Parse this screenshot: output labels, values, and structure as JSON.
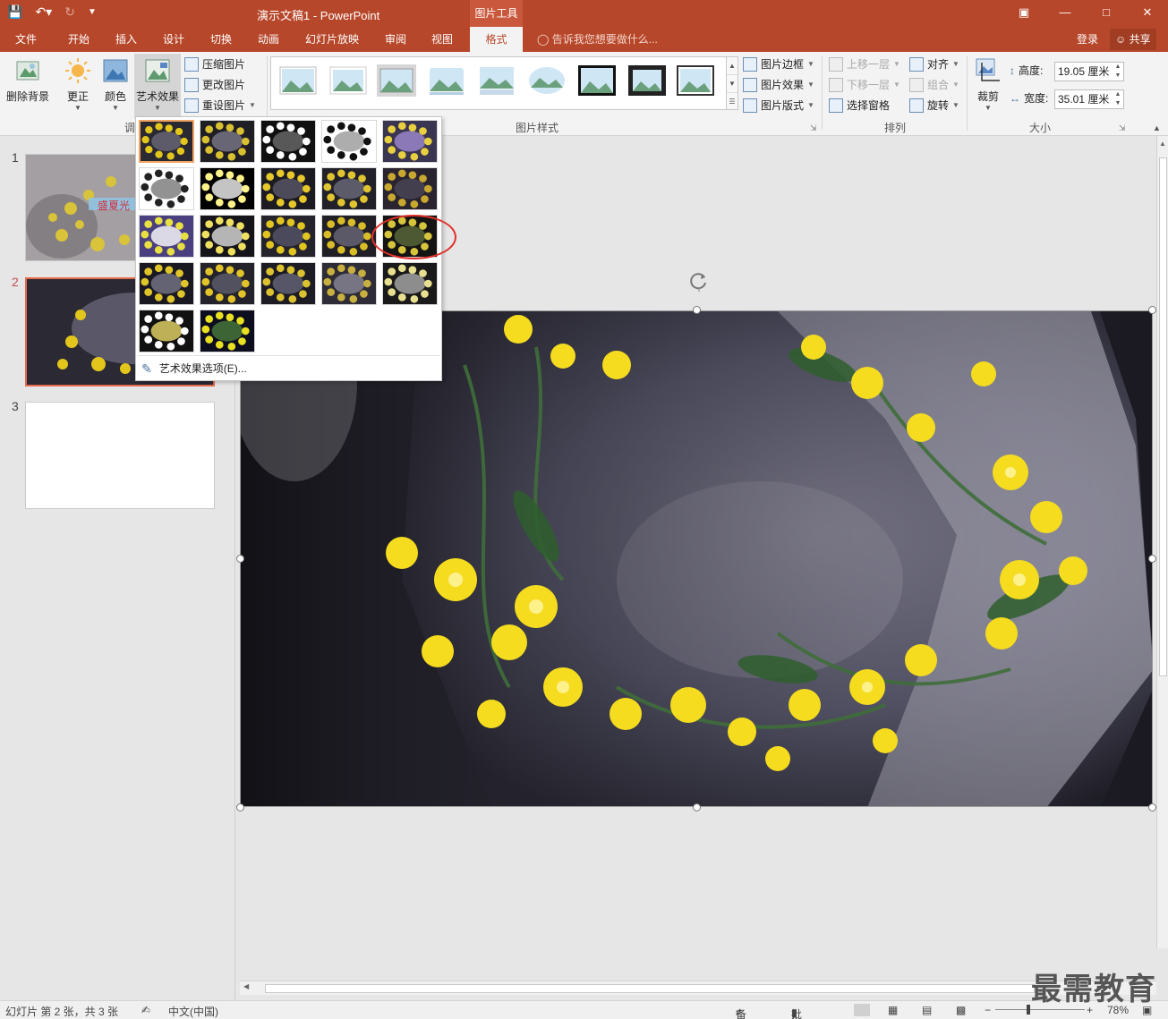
{
  "titlebar": {
    "doc_title": "演示文稿1 - PowerPoint",
    "tools_label": "图片工具"
  },
  "tabs": [
    "文件",
    "开始",
    "插入",
    "设计",
    "切换",
    "动画",
    "幻灯片放映",
    "审阅",
    "视图",
    "格式"
  ],
  "active_tab": "格式",
  "tellme": "告诉我您想要做什么...",
  "login": "登录",
  "share": "共享",
  "ribbon": {
    "remove_bg": "删除背景",
    "corrections": "更正",
    "color": "颜色",
    "art_effects": "艺术效果",
    "compress": "压缩图片",
    "change_pic": "更改图片",
    "reset_pic": "重设图片",
    "adjust_group": "调",
    "styles_group": "图片样式",
    "pic_border": "图片边框",
    "pic_effects": "图片效果",
    "pic_layout": "图片版式",
    "bring_forward": "上移一层",
    "send_backward": "下移一层",
    "selection_pane": "选择窗格",
    "align": "对齐",
    "group": "组合",
    "rotate": "旋转",
    "arrange_group": "排列",
    "crop": "裁剪",
    "height_label": "高度:",
    "height_value": "19.05 厘米",
    "width_label": "宽度:",
    "width_value": "35.01 厘米",
    "size_group": "大小"
  },
  "slides": [
    {
      "num": "1",
      "caption": "盛夏光"
    },
    {
      "num": "2"
    },
    {
      "num": "3"
    }
  ],
  "dropdown": {
    "option": "艺术效果选项(E)..."
  },
  "status": {
    "slide_info": "幻灯片 第 2 张，共 3 张",
    "language": "中文(中国)",
    "notes": "备注",
    "comments": "批注",
    "zoom": "78%"
  },
  "watermark": "最需教育",
  "colors": {
    "accent": "#b7472a",
    "selection": "#e46a4c",
    "highlight_circle": "#e0302a"
  }
}
